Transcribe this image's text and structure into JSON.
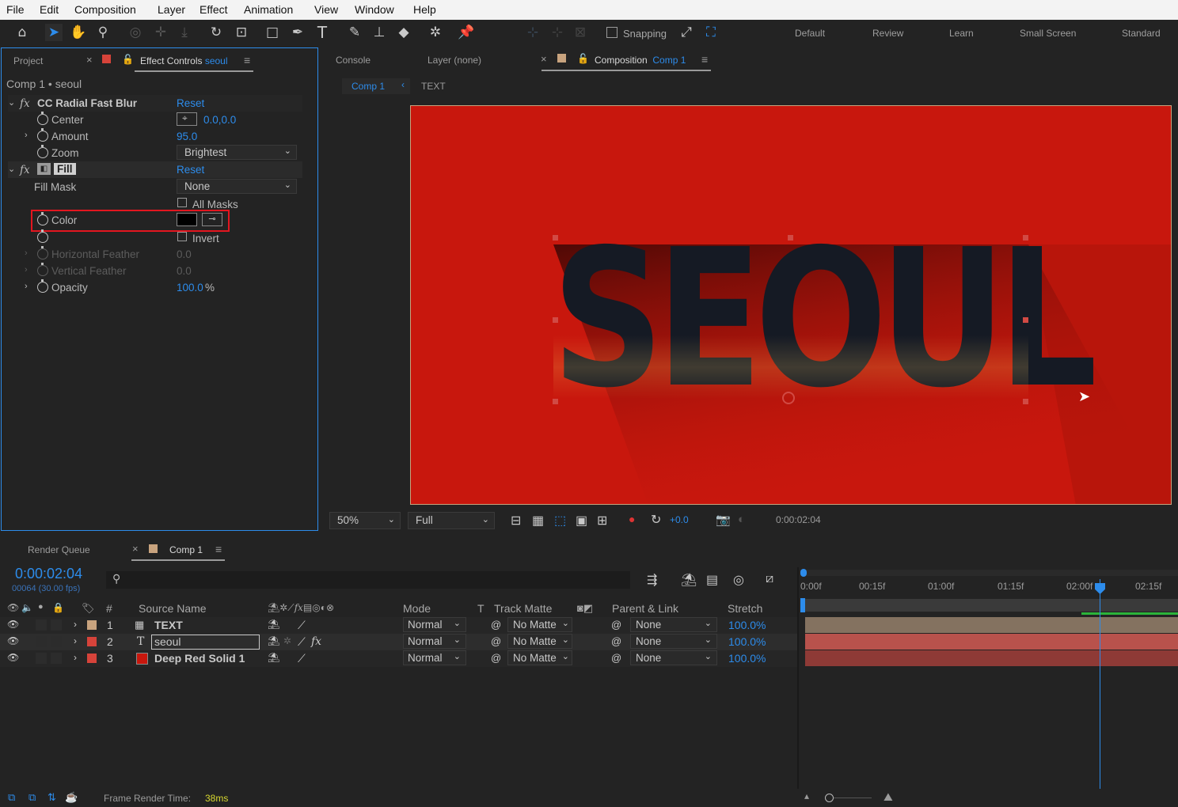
{
  "menu": [
    "File",
    "Edit",
    "Composition",
    "Layer",
    "Effect",
    "Animation",
    "View",
    "Window",
    "Help"
  ],
  "toolbar": {
    "snapping_label": "Snapping",
    "workspaces": [
      "Default",
      "Review",
      "Learn",
      "Small Screen",
      "Standard"
    ]
  },
  "left_panel": {
    "tabs": {
      "project": "Project",
      "effect_controls": "Effect Controls",
      "effect_controls_layer": "seoul"
    },
    "breadcrumb": "Comp 1 • seoul",
    "effects": {
      "radial_blur": {
        "name": "CC Radial Fast Blur",
        "reset": "Reset",
        "center_label": "Center",
        "center_value": "0.0,0.0",
        "amount_label": "Amount",
        "amount_value": "95.0",
        "zoom_label": "Zoom",
        "zoom_value": "Brightest"
      },
      "fill": {
        "name": "Fill",
        "reset": "Reset",
        "fill_mask_label": "Fill Mask",
        "fill_mask_value": "None",
        "all_masks_label": "All Masks",
        "color_label": "Color",
        "color_value": "#000000",
        "invert_label": "Invert",
        "h_feather_label": "Horizontal Feather",
        "h_feather_value": "0.0",
        "v_feather_label": "Vertical Feather",
        "v_feather_value": "0.0",
        "opacity_label": "Opacity",
        "opacity_value": "100.0",
        "opacity_unit": "%"
      }
    }
  },
  "viewer": {
    "tabs": {
      "console": "Console",
      "layer": "Layer (none)",
      "composition": "Composition",
      "composition_name": "Comp 1"
    },
    "nav_comp": "Comp 1",
    "nav_layer": "TEXT",
    "main_text": "SEOUL",
    "zoom": "50%",
    "resolution": "Full",
    "exposure": "+0.0",
    "timecode": "0:00:02:04",
    "bg_color": "#c8170d"
  },
  "timeline": {
    "tabs": {
      "render_queue": "Render Queue",
      "comp": "Comp 1"
    },
    "timecode": "0:00:02:04",
    "frames": "00064 (30.00 fps)",
    "search_placeholder": "",
    "columns": {
      "num": "#",
      "source_name": "Source Name",
      "mode": "Mode",
      "t": "T",
      "track_matte": "Track Matte",
      "parent": "Parent & Link",
      "stretch": "Stretch"
    },
    "ruler": [
      "0:00f",
      "00:15f",
      "01:00f",
      "01:15f",
      "02:00f",
      "02:15f"
    ],
    "layers": [
      {
        "num": "1",
        "name": "TEXT",
        "mode": "Normal",
        "matte": "No Matte",
        "parent": "None",
        "stretch": "100.0%",
        "label_color": "#c8a37e"
      },
      {
        "num": "2",
        "name": "seoul",
        "mode": "Normal",
        "matte": "No Matte",
        "parent": "None",
        "stretch": "100.0%",
        "label_color": "#d6433a"
      },
      {
        "num": "3",
        "name": "Deep Red Solid 1",
        "mode": "Normal",
        "matte": "No Matte",
        "parent": "None",
        "stretch": "100.0%",
        "label_color": "#d6433a"
      }
    ],
    "frame_render_label": "Frame Render Time:",
    "frame_render_value": "38ms"
  }
}
